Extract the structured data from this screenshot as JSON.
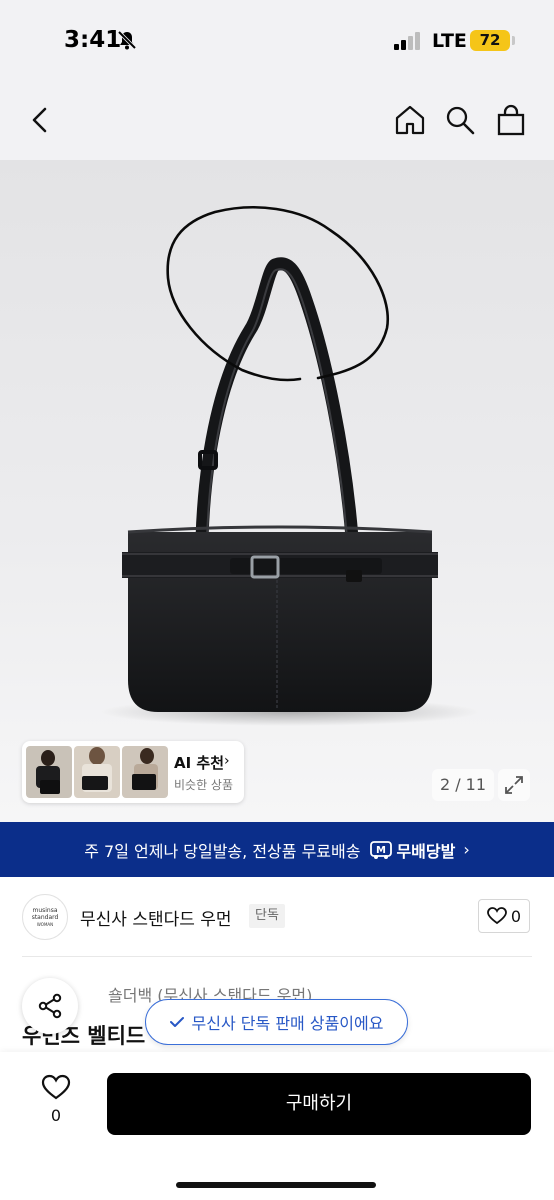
{
  "status_bar": {
    "time": "3:41",
    "network": "LTE",
    "battery": "72",
    "icons": [
      "bell-slash-icon",
      "signal-icon"
    ]
  },
  "nav": {
    "icons": [
      "back-chevron-icon",
      "home-icon",
      "search-icon",
      "shopping-bag-icon"
    ]
  },
  "gallery": {
    "ai_recommend": {
      "title": "AI 추천",
      "subtitle": "비슷한 상품",
      "chevron": "›"
    },
    "page_counter": "2 / 11",
    "expand_icon": "expand-icon"
  },
  "delivery_banner": {
    "text": "주 7일 언제나 당일발송, 전상품 무료배송",
    "logo_label": "무배당발",
    "chevron": "›"
  },
  "brand": {
    "logo_text_line1": "musinsa",
    "logo_text_line2": "standard",
    "logo_text_line3": "WOMAN",
    "name": "무신사 스탠다드 우먼",
    "badge": "단독",
    "like_count": "0"
  },
  "product": {
    "category_text": "숄더백 (무신사 스탠다드 우먼)",
    "title_partial": "우먼즈 벨티드"
  },
  "toast": {
    "text": "무신사 단독 판매 상품이에요"
  },
  "bottom_bar": {
    "wish_count": "0",
    "buy_label": "구매하기"
  },
  "colors": {
    "banner_bg": "#0b2e8a",
    "battery": "#f5c518",
    "toast_accent": "#2858c6",
    "buy_button": "#000000"
  }
}
